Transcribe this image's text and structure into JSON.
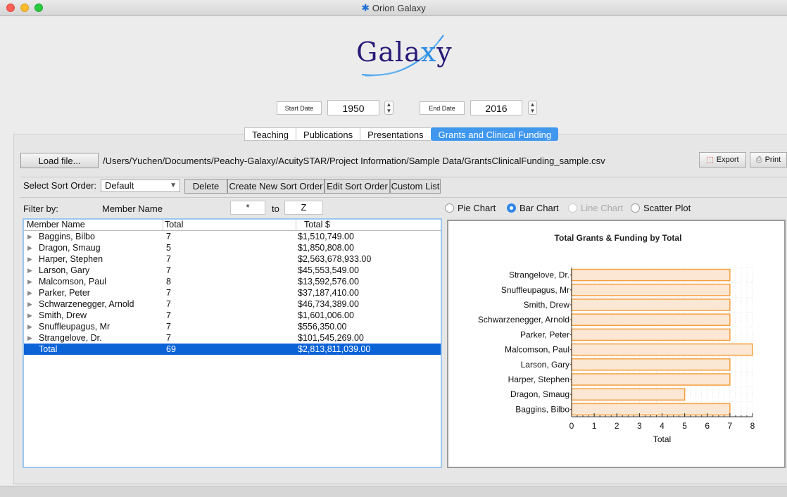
{
  "window": {
    "title": "Orion Galaxy"
  },
  "logo": {
    "text_before": "Gala",
    "text_x": "x",
    "text_after": "y"
  },
  "dates": {
    "start_label": "Start Date",
    "start_value": "1950",
    "end_label": "End Date",
    "end_value": "2016"
  },
  "tabs": [
    "Teaching",
    "Publications",
    "Presentations",
    "Grants and Clinical Funding"
  ],
  "file": {
    "load_label": "Load file...",
    "path": "/Users/Yuchen/Documents/Peachy-Galaxy/AcuitySTAR/Project Information/Sample Data/GrantsClinicalFunding_sample.csv",
    "export_label": "Export",
    "print_label": "Print"
  },
  "sort": {
    "label": "Select Sort Order:",
    "selected": "Default",
    "delete_label": "Delete",
    "create_label": "Create New Sort Order",
    "edit_label": "Edit Sort Order",
    "custom_label": "Custom List"
  },
  "filter": {
    "label": "Filter by:",
    "field": "Member Name",
    "from": "*",
    "to_label": "to",
    "to": "Z"
  },
  "chart_options": {
    "pie": "Pie Chart",
    "bar": "Bar Chart",
    "line": "Line Chart",
    "scatter": "Scatter Plot",
    "selected": "bar"
  },
  "table": {
    "columns": [
      "Member Name",
      "Total",
      "Total $"
    ],
    "rows": [
      [
        "Baggins, Bilbo",
        "7",
        "$1,510,749.00"
      ],
      [
        "Dragon, Smaug",
        "5",
        "$1,850,808.00"
      ],
      [
        "Harper, Stephen",
        "7",
        "$2,563,678,933.00"
      ],
      [
        "Larson, Gary",
        "7",
        "$45,553,549.00"
      ],
      [
        "Malcomson, Paul",
        "8",
        "$13,592,576.00"
      ],
      [
        "Parker, Peter",
        "7",
        "$37,187,410.00"
      ],
      [
        "Schwarzenegger, Arnold",
        "7",
        "$46,734,389.00"
      ],
      [
        "Smith, Drew",
        "7",
        "$1,601,006.00"
      ],
      [
        "Snuffleupagus, Mr",
        "7",
        "$556,350.00"
      ],
      [
        "Strangelove, Dr.",
        "7",
        "$101,545,269.00"
      ]
    ],
    "total": [
      "Total",
      "69",
      "$2,813,811,039.00"
    ]
  },
  "chart_data": {
    "type": "bar",
    "orientation": "horizontal",
    "title": "Total Grants & Funding by Total",
    "xlabel": "Total",
    "ylabel": "",
    "categories": [
      "Strangelove, Dr.",
      "Snuffleupagus, Mr",
      "Smith, Drew",
      "Schwarzenegger, Arnold",
      "Parker, Peter",
      "Malcomson, Paul",
      "Larson, Gary",
      "Harper, Stephen",
      "Dragon, Smaug",
      "Baggins, Bilbo"
    ],
    "values": [
      7,
      7,
      7,
      7,
      7,
      8,
      7,
      7,
      5,
      7
    ],
    "xlim": [
      0,
      8
    ],
    "xticks": [
      0,
      1,
      2,
      3,
      4,
      5,
      6,
      7,
      8
    ],
    "grid": true,
    "bar_color": "#f5a040",
    "bar_fill": "#fbe7d3"
  }
}
